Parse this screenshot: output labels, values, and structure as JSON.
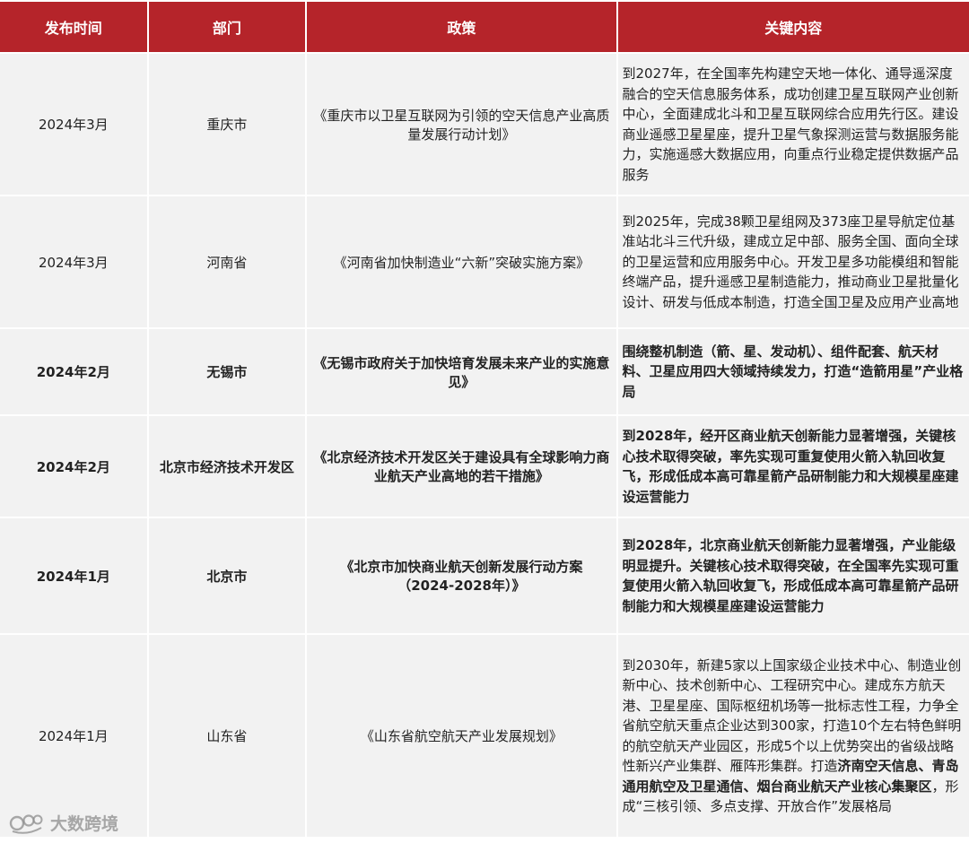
{
  "header": {
    "col_date": "发布时间",
    "col_dept": "部门",
    "col_policy": "政策",
    "col_content": "关键内容"
  },
  "rows": [
    {
      "date": "2024年3月",
      "dept": "重庆市",
      "policy": "《重庆市以卫星互联网为引领的空天信息产业高质量发展行动计划》",
      "content": "到2027年，在全国率先构建空天地一体化、通导遥深度融合的空天信息服务体系，成功创建卫星互联网产业创新中心，全面建成北斗和卫星互联网综合应用先行区。建设商业遥感卫星星座，提升卫星气象探测运营与数据服务能力，实施遥感大数据应用，向重点行业稳定提供数据产品服务",
      "bold": false
    },
    {
      "date": "2024年3月",
      "dept": "河南省",
      "policy": "《河南省加快制造业“六新”突破实施方案》",
      "content": "到2025年，完成38颗卫星组网及373座卫星导航定位基准站北斗三代升级，建成立足中部、服务全国、面向全球的卫星运营和应用服务中心。开发卫星多功能模组和智能终端产品，提升遥感卫星制造能力，推动商业卫星批量化设计、研发与低成本制造，打造全国卫星及应用产业高地",
      "bold": false
    },
    {
      "date": "2024年2月",
      "dept": "无锡市",
      "policy": "《无锡市政府关于加快培育发展未来产业的实施意见》",
      "content": "围绕整机制造（箭、星、发动机）、组件配套、航天材料、卫星应用四大领域持续发力，打造“造箭用星”产业格局",
      "bold": true
    },
    {
      "date": "2024年2月",
      "dept": "北京市经济技术开发区",
      "policy": "《北京经济技术开发区关于建设具有全球影响力商业航天产业高地的若干措施》",
      "content": "到2028年，经开区商业航天创新能力显著增强，关键核心技术取得突破，率先实现可重复使用火箭入轨回收复飞，形成低成本高可靠星箭产品研制能力和大规模星座建设运营能力",
      "bold": true
    },
    {
      "date": "2024年1月",
      "dept": "北京市",
      "policy": "《北京市加快商业航天创新发展行动方案（2024-2028年）》",
      "content": "到2028年，北京商业航天创新能力显著增强，产业能级明显提升。关键核心技术取得突破，在全国率先实现可重复使用火箭入轨回收复飞，形成低成本高可靠星箭产品研制能力和大规模星座建设运营能力",
      "bold": true
    },
    {
      "date": "2024年1月",
      "dept": "山东省",
      "policy": "《山东省航空航天产业发展规划》",
      "content_parts": [
        "到2030年，新建5家以上国家级企业技术中心、制造业创新中心、技术创新中心、工程研究中心。建成东方航天港、卫星星座、国际枢纽机场等一批标志性工程，力争全省航空航天重点企业达到300家，打造10个左右特色鲜明的航空航天产业园区，形成5个以上优势突出的省级战略性新兴产业集群、雁阵形集群。打造",
        "济南空天信息、青岛通用航空及卫星通信、烟台商业航天产业核心集聚区",
        "，形成“三核引领、多点支撑、开放合作”发展格局"
      ],
      "bold": false
    }
  ],
  "watermark": {
    "text": "大数跨境",
    "icon": "dashuju-logo-icon"
  }
}
